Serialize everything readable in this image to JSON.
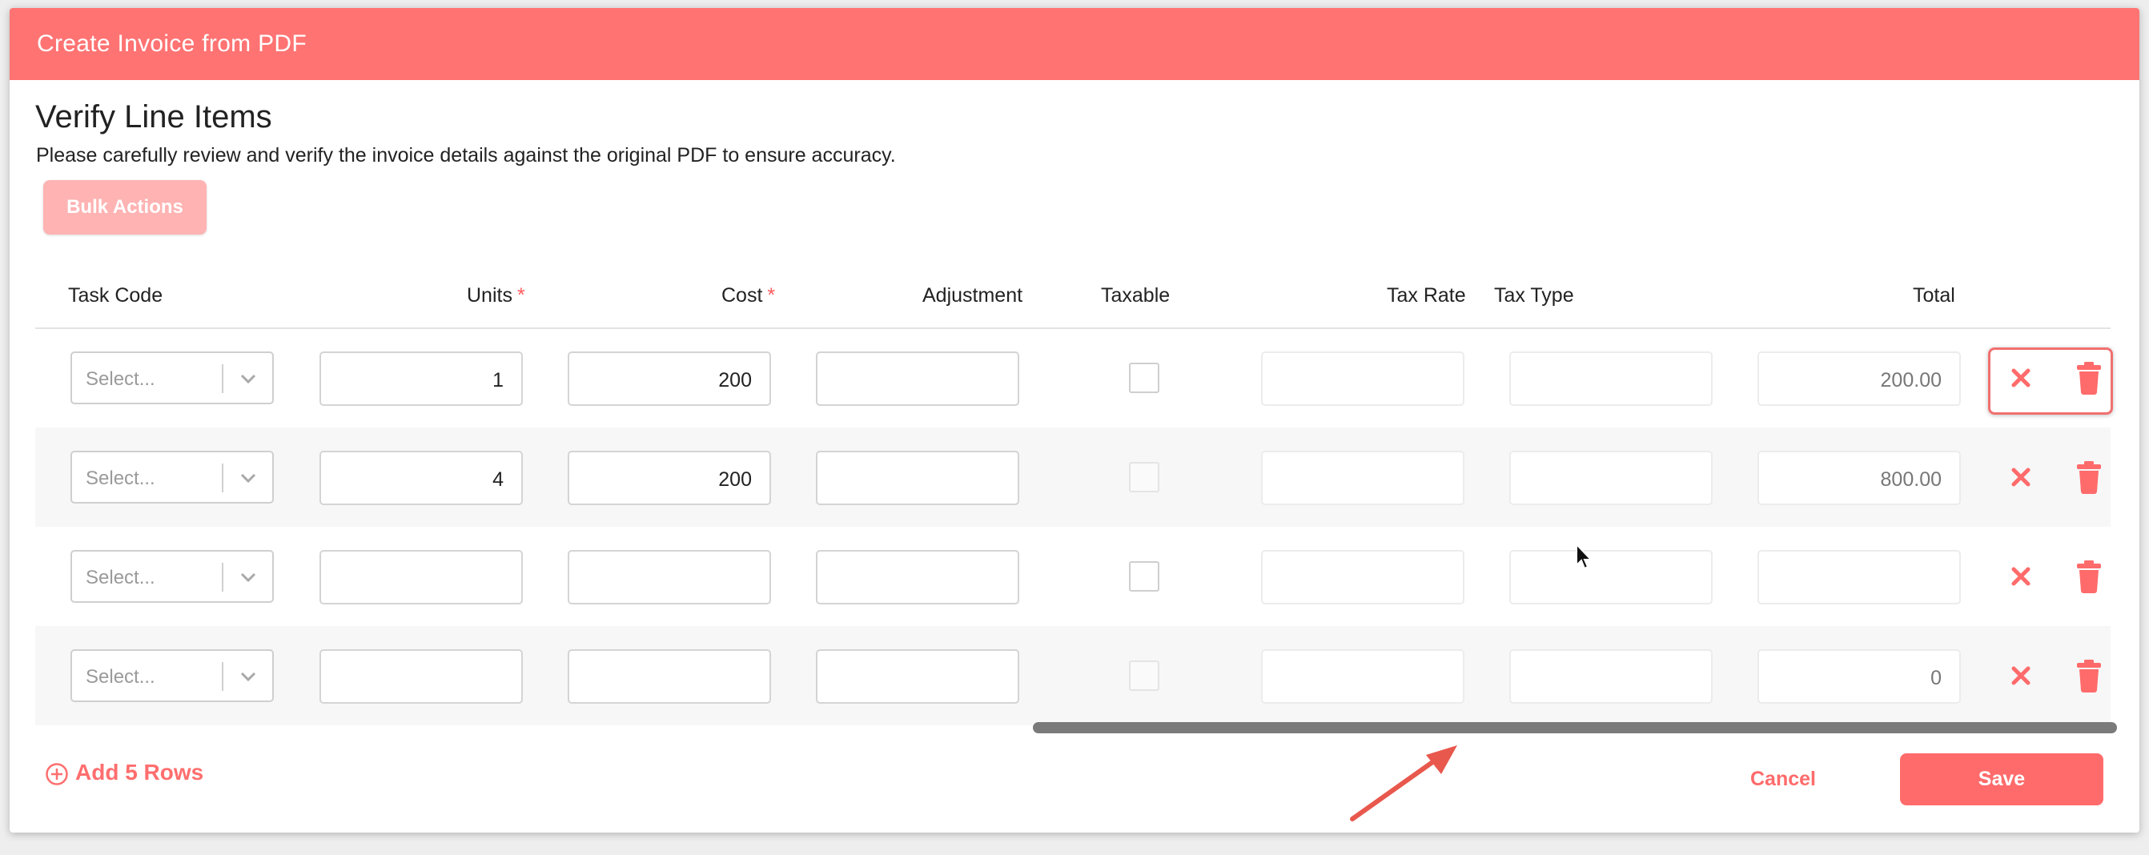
{
  "modal": {
    "title": "Create Invoice from PDF"
  },
  "section": {
    "title": "Verify Line Items",
    "description": "Please carefully review and verify the invoice details against the original PDF to ensure accuracy."
  },
  "bulk_actions_label": "Bulk Actions",
  "columns": {
    "task_code": "Task Code",
    "units": "Units",
    "cost": "Cost",
    "adjustment": "Adjustment",
    "taxable": "Taxable",
    "tax_rate": "Tax Rate",
    "tax_type": "Tax Type",
    "total": "Total",
    "required_marker": "*"
  },
  "select_placeholder": "Select...",
  "rows": [
    {
      "units": "1",
      "cost": "200",
      "adjustment": "",
      "taxable": false,
      "tax_rate": "",
      "tax_type": "",
      "total": "200.00"
    },
    {
      "units": "4",
      "cost": "200",
      "adjustment": "",
      "taxable": false,
      "tax_rate": "",
      "tax_type": "",
      "total": "800.00"
    },
    {
      "units": "",
      "cost": "",
      "adjustment": "",
      "taxable": false,
      "tax_rate": "",
      "tax_type": "",
      "total": ""
    },
    {
      "units": "",
      "cost": "",
      "adjustment": "",
      "taxable": false,
      "tax_rate": "",
      "tax_type": "",
      "total": "0"
    }
  ],
  "footer": {
    "add_rows_label": "Add 5 Rows",
    "cancel_label": "Cancel",
    "save_label": "Save"
  },
  "icons": {
    "add": "plus-circle-icon",
    "chevron": "chevron-down-icon",
    "clear": "close-icon",
    "delete": "trash-icon",
    "annotation": "arrow-annotation-icon",
    "cursor": "mouse-cursor-icon"
  },
  "colors": {
    "accent": "#ff7373",
    "accent_strong": "#ff6b6b",
    "bulk_disabled": "#ffb3b3",
    "scrollbar": "#7a7a7a"
  }
}
